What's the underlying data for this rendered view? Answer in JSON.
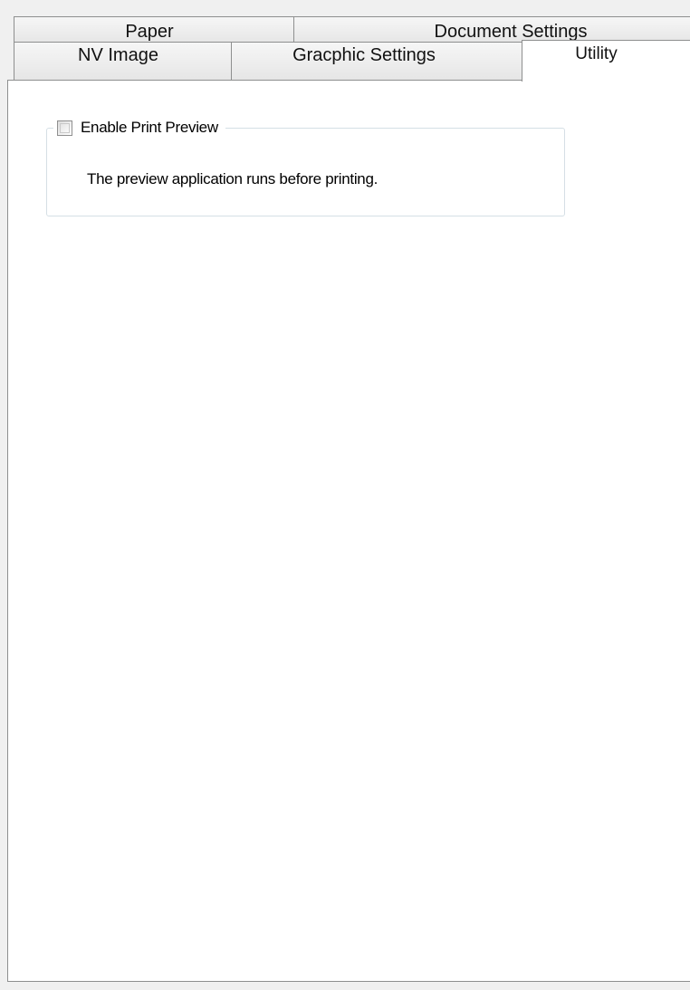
{
  "tabs": {
    "row1": [
      {
        "label": "Paper"
      },
      {
        "label": "Document Settings"
      }
    ],
    "row2": [
      {
        "label": "NV Image"
      },
      {
        "label": "Gracphic Settings"
      },
      {
        "label": "Utility",
        "selected": true
      }
    ]
  },
  "utility": {
    "print_preview": {
      "label": "Enable Print Preview",
      "checked": false,
      "description": "The preview application runs before printing."
    }
  }
}
